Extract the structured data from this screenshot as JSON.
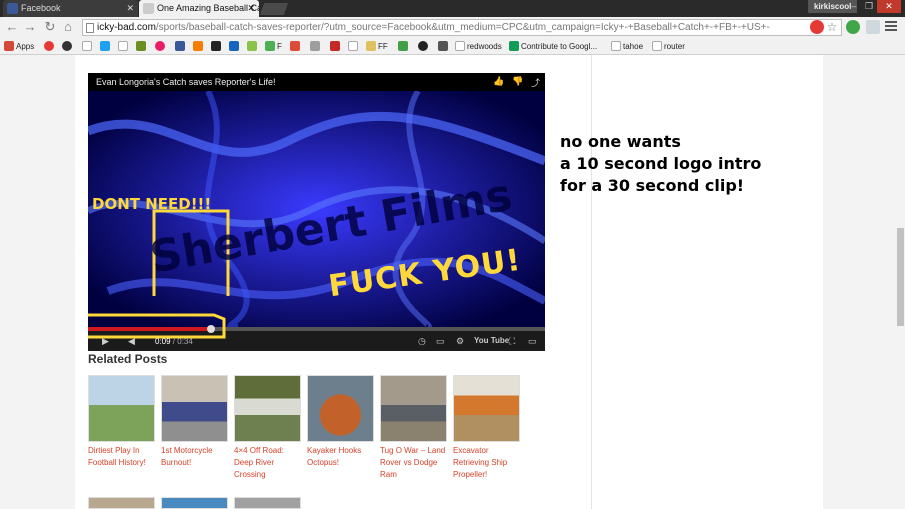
{
  "browser": {
    "tabs": [
      {
        "title": "Facebook",
        "favicon_color": "#3b5998"
      },
      {
        "title": "One Amazing Baseball Catc",
        "favicon_color": "#cccccc"
      }
    ],
    "user_badge": "kirkiscool",
    "window_buttons": [
      "–",
      "❐",
      "✕"
    ],
    "url_domain": "icky-bad.com",
    "url_rest": "/sports/baseball-catch-saves-reporter/?utm_source=Facebook&utm_medium=CPC&utm_campaign=Icky+-+Baseball+Catch+-+FB+-+US+-",
    "bookmarks": [
      {
        "label": "Apps",
        "color": "#d34836"
      },
      {
        "label": "",
        "color": "#e53935"
      },
      {
        "label": "",
        "color": "#333333"
      },
      {
        "label": "",
        "color": "#bbbbbb"
      },
      {
        "label": "",
        "color": "#1da1f2"
      },
      {
        "label": "",
        "color": "#cccccc"
      },
      {
        "label": "",
        "color": "#6b8e23"
      },
      {
        "label": "",
        "color": "#e91e63"
      },
      {
        "label": "",
        "color": "#3b5998"
      },
      {
        "label": "",
        "color": "#f57d00"
      },
      {
        "label": "",
        "color": "#222222"
      },
      {
        "label": "",
        "color": "#1565c0"
      },
      {
        "label": "",
        "color": "#8bc34a"
      },
      {
        "label": "F",
        "color": "#4caf50"
      },
      {
        "label": "",
        "color": "#dd4b39"
      },
      {
        "label": "",
        "color": "#9e9e9e"
      },
      {
        "label": "",
        "color": "#c62828"
      },
      {
        "label": "",
        "color": "#999999"
      },
      {
        "label": "",
        "color": "#888888"
      },
      {
        "label": "FF",
        "color": "#e0c060"
      },
      {
        "label": "",
        "color": "#43a047"
      },
      {
        "label": "",
        "color": "#222222"
      },
      {
        "label": "",
        "color": "#555555"
      },
      {
        "label": "redwoods",
        "color": "#cccccc"
      },
      {
        "label": "Contribute to Googl...",
        "color": "#0f9d58"
      },
      {
        "label": "tahoe",
        "color": "#cccccc"
      },
      {
        "label": "router",
        "color": "#cccccc"
      }
    ]
  },
  "video": {
    "title": "Evan Longoria's Catch saves Reporter's Life!",
    "watermark": "Sherbert Films",
    "annotation_big": "FUCK YOU!",
    "annotation_small": "DONT NEED!!!",
    "time_current": "0:09",
    "time_duration": " / 0:34",
    "progress_fraction": 0.27,
    "progress_color": "#cc181e",
    "annotation_color": "#ffd83a",
    "youtube_label": "You Tube"
  },
  "note_lines": [
    "no one wants",
    "a 10 second logo intro",
    "for a 30 second clip!"
  ],
  "related": {
    "title": "Related Posts",
    "posts": [
      {
        "caption": "Dirtiest Play In Football History!",
        "thumb": "#8fa870"
      },
      {
        "caption": "1st Motorcycle Burnout!",
        "thumb": "#9a9a9a"
      },
      {
        "caption": "4×4 Off Road: Deep River Crossing",
        "thumb": "#7a8a5a"
      },
      {
        "caption": "Kayaker Hooks Octopus!",
        "thumb": "#b06a3a"
      },
      {
        "caption": "Tug O War – Land Rover vs Dodge Ram",
        "thumb": "#8a7f70"
      },
      {
        "caption": "Excavator Retrieving Ship Propeller!",
        "thumb": "#c27a3a"
      }
    ],
    "row2_thumbs": [
      "#b9a890",
      "#4a8ac0",
      "#a0a0a0"
    ]
  }
}
